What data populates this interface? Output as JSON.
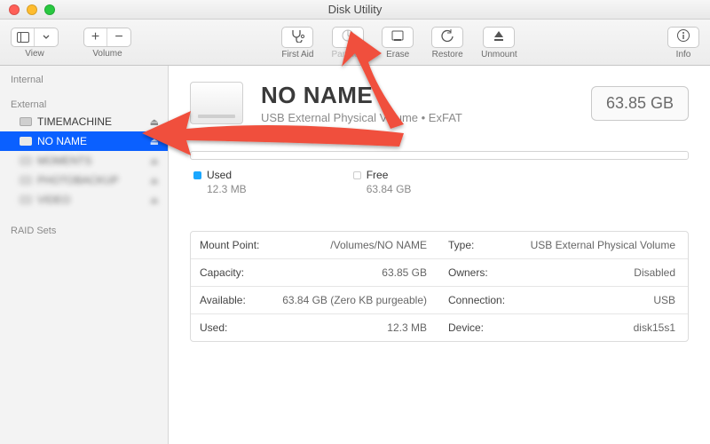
{
  "window": {
    "title": "Disk Utility"
  },
  "toolbar": {
    "view_label": "View",
    "volume_label": "Volume",
    "first_aid": "First Aid",
    "partition": "Partition",
    "erase": "Erase",
    "restore": "Restore",
    "unmount": "Unmount",
    "info": "Info"
  },
  "sidebar": {
    "internal_header": "Internal",
    "external_header": "External",
    "items": [
      {
        "label": "TIMEMACHINE",
        "selected": false
      },
      {
        "label": "NO NAME",
        "selected": true
      },
      {
        "label": "MOMENTS",
        "selected": false,
        "blurred": true
      },
      {
        "label": "PHOTOBACKUP",
        "selected": false,
        "blurred": true
      },
      {
        "label": "VIDEO",
        "selected": false,
        "blurred": true
      }
    ],
    "raid_header": "RAID Sets"
  },
  "volume": {
    "name": "NO NAME",
    "subtitle": "USB External Physical Volume • ExFAT",
    "size": "63.85 GB",
    "used_label": "Used",
    "used_value": "12.3 MB",
    "free_label": "Free",
    "free_value": "63.84 GB"
  },
  "details": {
    "mount_point_k": "Mount Point:",
    "mount_point_v": "/Volumes/NO NAME",
    "type_k": "Type:",
    "type_v": "USB External Physical Volume",
    "capacity_k": "Capacity:",
    "capacity_v": "63.85 GB",
    "owners_k": "Owners:",
    "owners_v": "Disabled",
    "available_k": "Available:",
    "available_v": "63.84 GB (Zero KB purgeable)",
    "connection_k": "Connection:",
    "connection_v": "USB",
    "used_k": "Used:",
    "used_v": "12.3 MB",
    "device_k": "Device:",
    "device_v": "disk15s1"
  },
  "colors": {
    "accent": "#0a60ff",
    "used_swatch": "#1aa7ff",
    "free_swatch": "#ffffff",
    "arrow": "#f0503c"
  }
}
